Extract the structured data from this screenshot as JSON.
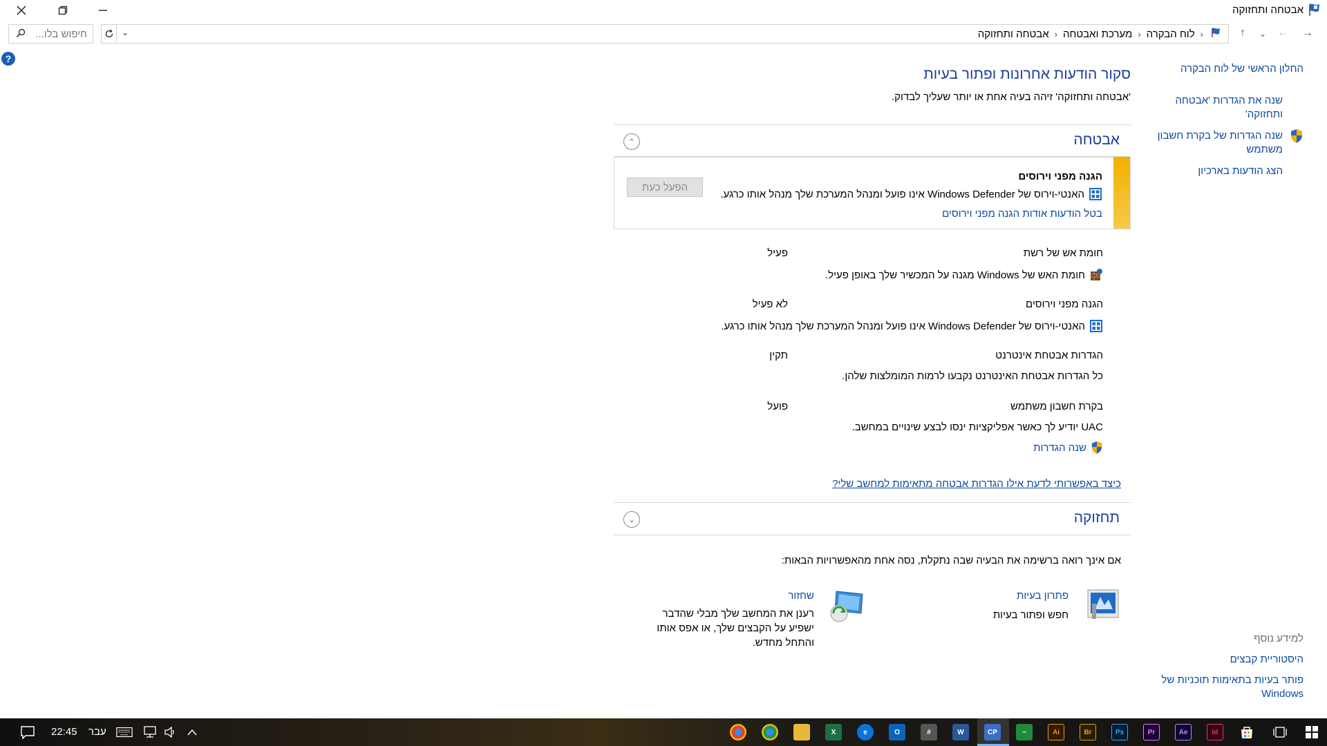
{
  "window": {
    "title": "אבטחה ותחזוקה"
  },
  "address": {
    "crumbs": [
      "לוח הבקרה",
      "מערכת ואבטחה",
      "אבטחה ותחזוקה"
    ],
    "search_placeholder": "חיפוש בלו..."
  },
  "sidebar": {
    "items": [
      {
        "label": "החלון הראשי של לוח הבקרה"
      },
      {
        "label": "שנה את הגדרות 'אבטחה ותחזוקה'"
      },
      {
        "label": "שנה הגדרות של בקרת חשבון משתמש"
      },
      {
        "label": "הצג הודעות בארכיון"
      }
    ],
    "see_also_header": "למידע נוסף",
    "see_also": [
      {
        "label": "היסטוריית קבצים"
      },
      {
        "label": "פותר בעיות בתאימות תוכניות של Windows"
      }
    ]
  },
  "main": {
    "title": "סקור הודעות אחרונות ופתור בעיות",
    "subtitle": "'אבטחה ותחזוקה' זיהה בעיה אחת או יותר שעליך לבדוק.",
    "security": {
      "header": "אבטחה",
      "alert": {
        "title": "הגנה מפני וירוסים",
        "text": "האנטי-וירוס של Windows Defender אינו פועל ומנהל המערכת שלך מנהל אותו כרגע.",
        "link": "בטל הודעות אודות הגנה מפני וירוסים",
        "button": "הפעל כעת"
      },
      "rows": [
        {
          "name": "חומת אש של רשת",
          "value": "פעיל",
          "desc": "חומת האש של Windows מגנה על המכשיר שלך באופן פעיל."
        },
        {
          "name": "הגנה מפני וירוסים",
          "value": "לא פעיל",
          "desc": "האנטי-וירוס של Windows Defender אינו פועל ומנהל המערכת שלך מנהל אותו כרגע."
        },
        {
          "name": "הגדרות אבטחת אינטרנט",
          "value": "תקין",
          "desc": "כל הגדרות אבטחת האינטרנט נקבעו לרמות המומלצות שלהן."
        },
        {
          "name": "בקרת חשבון משתמש",
          "value": "פועל",
          "desc": "UAC יודיע לך כאשר אפליקציות ינסו לבצע שינויים במחשב.",
          "link": "שנה הגדרות"
        }
      ],
      "howto": "כיצד באפשרותי לדעת אילו הגדרות אבטחה מתאימות למחשב שלי?"
    },
    "maintenance": {
      "header": "תחזוקה",
      "intro": "אם אינך רואה ברשימה את הבעיה שבה נתקלת, נסה אחת מהאפשרויות הבאות:",
      "tools": [
        {
          "title": "פתרון בעיות",
          "desc": "חפש ופתור בעיות"
        },
        {
          "title": "שחזור",
          "desc": "רענן את המחשב שלך מבלי שהדבר ישפיע על הקבצים שלך, או אפס אותו והתחל מחדש."
        }
      ]
    }
  },
  "taskbar": {
    "time": "22:45",
    "language": "עבר"
  }
}
